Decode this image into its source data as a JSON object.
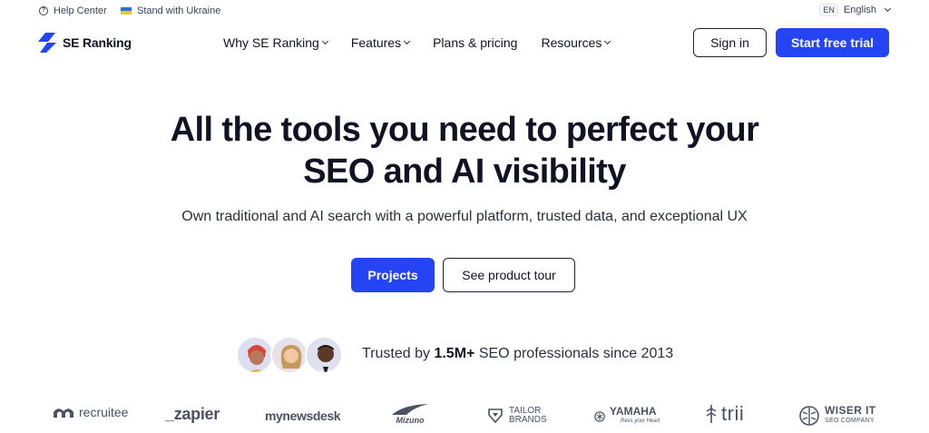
{
  "utility": {
    "help_center": "Help Center",
    "ukraine": "Stand with Ukraine",
    "lang_code": "EN",
    "lang_label": "English"
  },
  "brand": {
    "name": "SE Ranking",
    "color": "#2545f5"
  },
  "nav": {
    "items": [
      {
        "label": "Why SE Ranking",
        "has_dropdown": true
      },
      {
        "label": "Features",
        "has_dropdown": true
      },
      {
        "label": "Plans & pricing",
        "has_dropdown": false
      },
      {
        "label": "Resources",
        "has_dropdown": true
      }
    ],
    "sign_in": "Sign in",
    "start_trial": "Start free trial"
  },
  "hero": {
    "title_line1": "All the tools you need to perfect your",
    "title_line2": "SEO and AI visibility",
    "subtitle": "Own traditional and AI search with a powerful platform, trusted data, and exceptional UX",
    "primary_cta": "Projects",
    "secondary_cta": "See product tour"
  },
  "trust": {
    "prefix": "Trusted by",
    "count": "1.5M+",
    "suffix": "SEO professionals since 2013"
  },
  "client_logos": {
    "recruitee": "recruitee",
    "zapier": "_zapier",
    "mynewsdesk": "mynewsdesk",
    "mizuno": "Mizuno",
    "tailor_line1": "TAILOR",
    "tailor_line2": "BRANDS",
    "yamaha": "YAMAHA",
    "yamaha_tag": "Revs your Heart",
    "trii": "trii",
    "wiser_line1": "WISER IT",
    "wiser_line2": "SEO COMPANY"
  }
}
